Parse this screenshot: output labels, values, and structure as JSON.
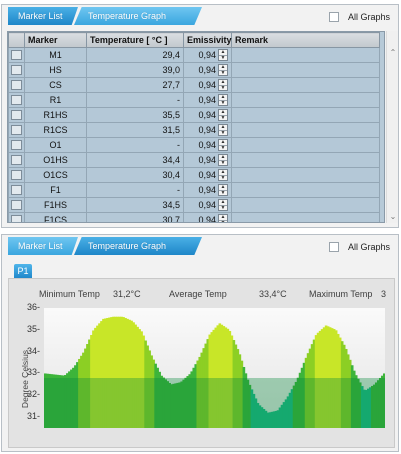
{
  "tabs": {
    "marker_list": "Marker List",
    "temperature_graph": "Temperature Graph"
  },
  "all_graphs_label": "All Graphs",
  "table": {
    "headers": [
      "Marker",
      "Temperature [ °C ]",
      "Emissivity",
      "Remark"
    ],
    "rows": [
      {
        "marker": "M1",
        "temp": "29,4",
        "emis": "0,94"
      },
      {
        "marker": "HS",
        "temp": "39,0",
        "emis": "0,94"
      },
      {
        "marker": "CS",
        "temp": "27,7",
        "emis": "0,94"
      },
      {
        "marker": "R1",
        "temp": "-",
        "emis": "0,94"
      },
      {
        "marker": "R1HS",
        "temp": "35,5",
        "emis": "0,94"
      },
      {
        "marker": "R1CS",
        "temp": "31,5",
        "emis": "0,94"
      },
      {
        "marker": "O1",
        "temp": "-",
        "emis": "0,94"
      },
      {
        "marker": "O1HS",
        "temp": "34,4",
        "emis": "0,94"
      },
      {
        "marker": "O1CS",
        "temp": "30,4",
        "emis": "0,94"
      },
      {
        "marker": "F1",
        "temp": "-",
        "emis": "0,94"
      },
      {
        "marker": "F1HS",
        "temp": "34,5",
        "emis": "0,94"
      },
      {
        "marker": "F1CS",
        "temp": "30,7",
        "emis": "0,94"
      }
    ]
  },
  "graph": {
    "profile_tab": "P1",
    "min_label": "Minimum Temp",
    "min_value": "31,2°C",
    "avg_label": "Average Temp",
    "avg_value": "33,4°C",
    "max_label": "Maximum Temp",
    "max_value": "3",
    "ylabel": "Degree Celsius"
  },
  "chart_data": {
    "type": "area",
    "title": "",
    "xlabel": "",
    "ylabel": "Degree Celsius",
    "ylim": [
      30.5,
      36
    ],
    "y_ticks": [
      "31",
      "32",
      "33",
      "34",
      "35",
      "36"
    ],
    "grid": false,
    "series": [
      {
        "values": [
          33.0,
          32.95,
          32.9,
          33.3,
          34.0,
          35.0,
          35.5,
          35.6,
          35.6,
          35.4,
          34.9,
          33.8,
          32.9,
          32.5,
          32.6,
          33.0,
          33.8,
          34.8,
          35.3,
          35.0,
          34.0,
          32.6,
          31.6,
          31.2,
          31.3,
          31.9,
          32.7,
          33.8,
          34.8,
          35.2,
          35.0,
          34.2,
          33.0,
          32.2,
          32.5,
          33.0
        ]
      }
    ]
  }
}
